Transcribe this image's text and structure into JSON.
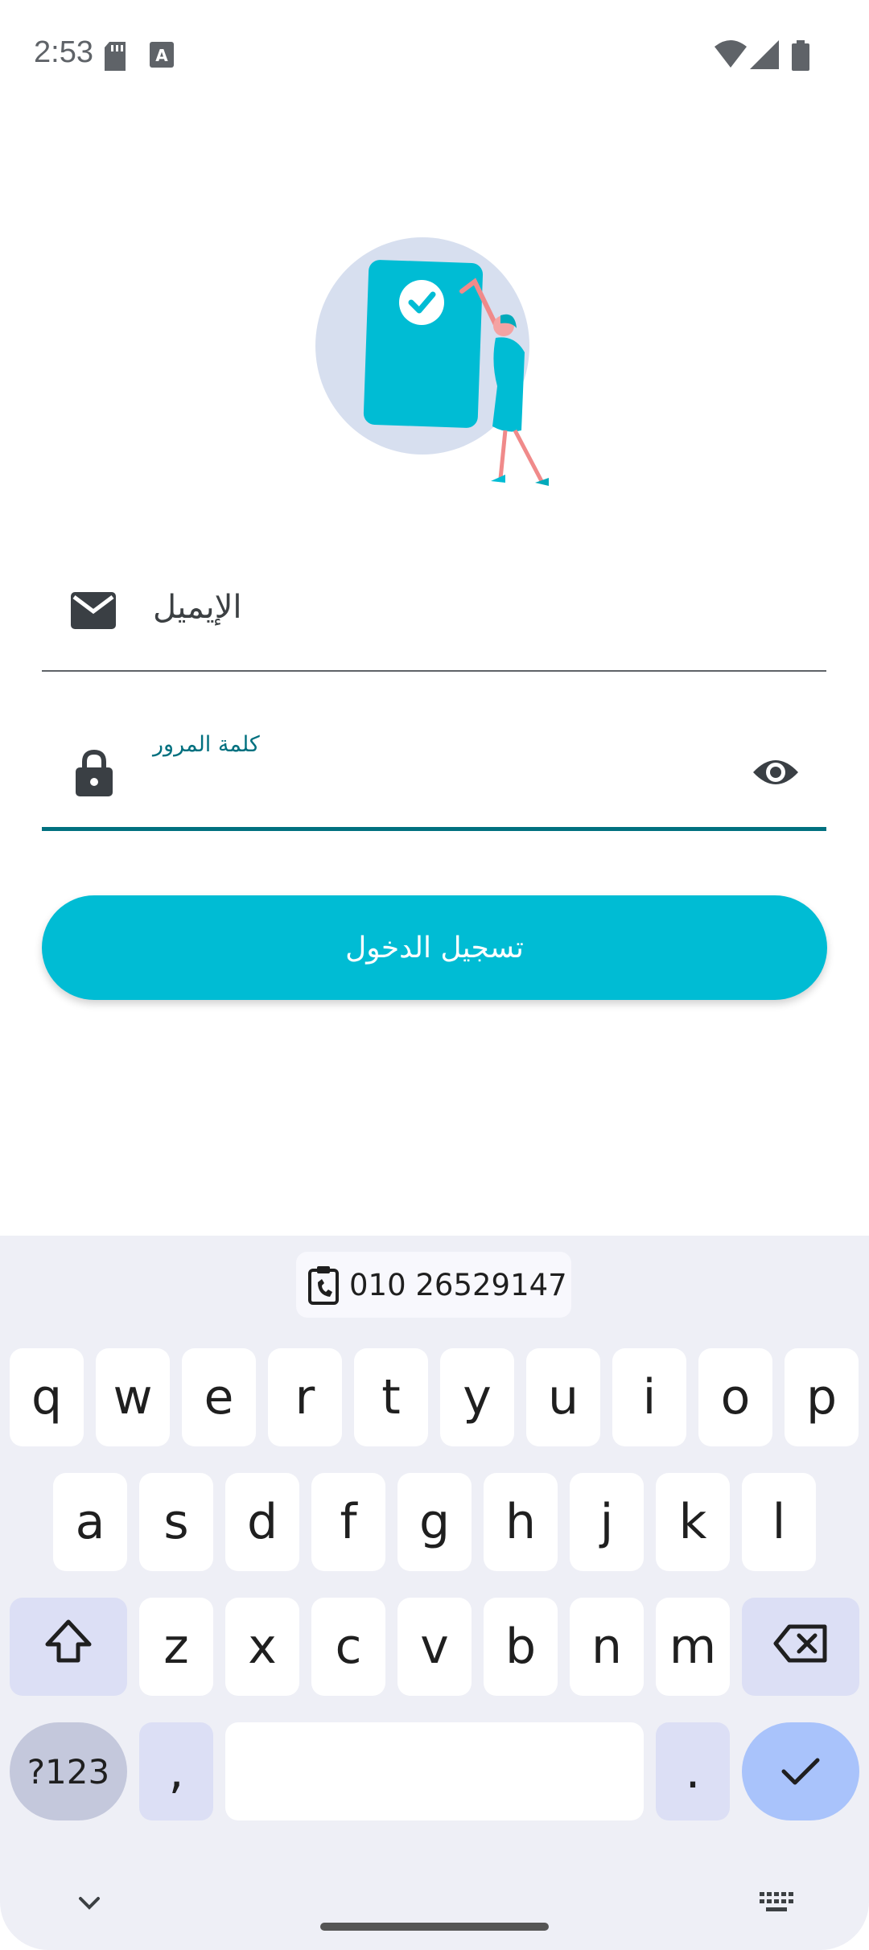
{
  "status_bar": {
    "time": "2:53",
    "icons": [
      "sd-card-icon",
      "keyboard-a-icon",
      "wifi-icon",
      "signal-icon",
      "battery-icon"
    ]
  },
  "illustration": {
    "icon": "checkmark-card-illustration"
  },
  "email_field": {
    "label": "الإيميل",
    "icon": "email-icon"
  },
  "password_field": {
    "label": "كلمة المرور",
    "icon": "lock-icon",
    "toggle_icon": "eye-icon"
  },
  "login_button": {
    "label": "تسجيل الدخول"
  },
  "colors": {
    "accent": "#00bcd4",
    "focus": "#00707f"
  },
  "keyboard": {
    "clipboard_suggestion": "010 26529147",
    "row1": [
      "q",
      "w",
      "e",
      "r",
      "t",
      "y",
      "u",
      "i",
      "o",
      "p"
    ],
    "row2": [
      "a",
      "s",
      "d",
      "f",
      "g",
      "h",
      "j",
      "k",
      "l"
    ],
    "row3": [
      "z",
      "x",
      "c",
      "v",
      "b",
      "n",
      "m"
    ],
    "num_key": "?123",
    "comma_key": ",",
    "period_key": "."
  }
}
